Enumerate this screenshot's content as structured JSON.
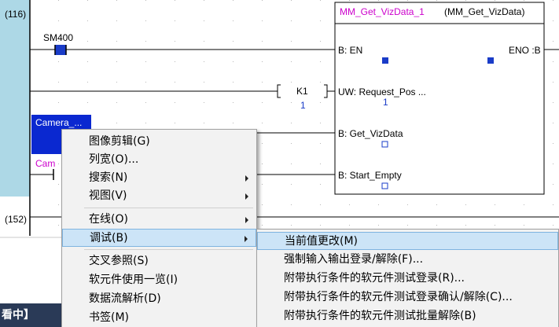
{
  "ladder": {
    "steps": [
      "(116)",
      "(152)"
    ],
    "contacts": {
      "sm400": "SM400",
      "camera1": "Camera_...",
      "camera2": "Cam"
    },
    "k1": {
      "label": "K1",
      "value": "1"
    },
    "fb": {
      "instance": "MM_Get_VizData_1",
      "type": "(MM_Get_VizData)",
      "inputs": [
        {
          "label": "B: EN"
        },
        {
          "label": "UW: Request_Pos ...",
          "value": "1"
        },
        {
          "label": "B: Get_VizData"
        },
        {
          "label": "B: Start_Empty"
        }
      ],
      "outputs": [
        {
          "label": "ENO :B"
        }
      ]
    }
  },
  "context_menu": {
    "items": [
      {
        "label": "图像剪辑(G)"
      },
      {
        "label": "列宽(O)..."
      },
      {
        "label": "搜索(N)",
        "submenu": true
      },
      {
        "label": "视图(V)",
        "submenu": true
      },
      {
        "label": "在线(O)",
        "submenu": true
      },
      {
        "label": "调试(B)",
        "submenu": true,
        "highlighted": true
      },
      {
        "label": "交叉参照(S)"
      },
      {
        "label": "软元件使用一览(I)"
      },
      {
        "label": "数据流解析(D)"
      },
      {
        "label": "书签(M)"
      }
    ]
  },
  "debug_submenu": {
    "items": [
      {
        "label": "当前值更改(M)",
        "highlighted": true
      },
      {
        "label": "强制输入输出登录/解除(F)..."
      },
      {
        "label": "附带执行条件的软元件测试登录(R)..."
      },
      {
        "label": "附带执行条件的软元件测试登录确认/解除(C)..."
      },
      {
        "label": "附带执行条件的软元件测试批量解除(B)"
      }
    ]
  },
  "status_bar": {
    "text": "看中】"
  },
  "colors": {
    "gutter": "#add8e6",
    "instance_magenta": "#cc00cc",
    "contact_blue": "#1a3cc8",
    "selected_contact": "#0a28d0",
    "highlight": "#cce4f7",
    "status_bg": "#2a3a57"
  }
}
